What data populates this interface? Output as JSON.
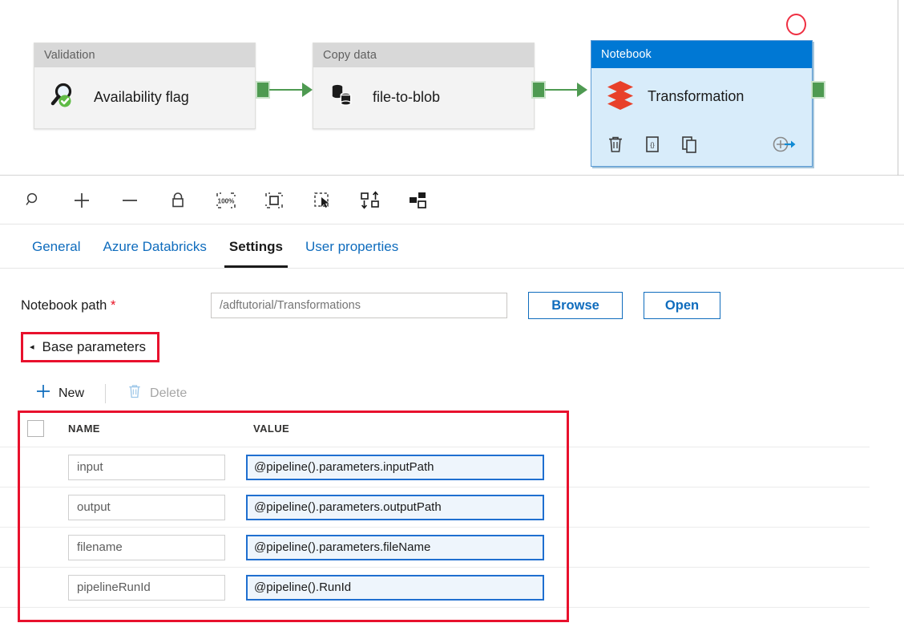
{
  "canvas": {
    "nodes": [
      {
        "type_label": "Validation",
        "name": "Availability flag",
        "icon": "magnifier-check-icon"
      },
      {
        "type_label": "Copy data",
        "name": "file-to-blob",
        "icon": "database-copy-icon"
      },
      {
        "type_label": "Notebook",
        "name": "Transformation",
        "icon": "databricks-layers-icon"
      }
    ],
    "selected_node_actions": [
      {
        "name": "delete-activity-icon",
        "label": "Delete"
      },
      {
        "name": "code-activity-icon",
        "label": "Code"
      },
      {
        "name": "clone-activity-icon",
        "label": "Clone"
      },
      {
        "name": "add-output-icon",
        "label": "Add output"
      }
    ],
    "annotation": "red-circle-highlight"
  },
  "toolbar": {
    "buttons": [
      {
        "name": "zoom-search-icon",
        "label": "Zoom"
      },
      {
        "name": "zoom-in-icon",
        "label": "Zoom in"
      },
      {
        "name": "zoom-out-icon",
        "label": "Zoom out"
      },
      {
        "name": "lock-icon",
        "label": "Lock canvas"
      },
      {
        "name": "zoom-100-percent-icon",
        "label": "100%"
      },
      {
        "name": "fit-to-screen-icon",
        "label": "Zoom to fit"
      },
      {
        "name": "marquee-select-icon",
        "label": "Marquee select"
      },
      {
        "name": "auto-align-icon",
        "label": "Auto align"
      },
      {
        "name": "auto-layout-icon",
        "label": "Auto layout"
      }
    ],
    "zoom_level_label": "100%"
  },
  "tabs": [
    {
      "label": "General",
      "active": false
    },
    {
      "label": "Azure Databricks",
      "active": false
    },
    {
      "label": "Settings",
      "active": true
    },
    {
      "label": "User properties",
      "active": false
    }
  ],
  "settings": {
    "notebook_path": {
      "label": "Notebook path",
      "required_marker": "*",
      "value": "",
      "placeholder": "/adftutorial/Transformations",
      "browse_label": "Browse",
      "open_label": "Open"
    },
    "base_parameters": {
      "caret": "◂",
      "title": "Base parameters",
      "new_label": "New",
      "delete_label": "Delete",
      "columns": [
        "NAME",
        "VALUE"
      ],
      "rows": [
        {
          "name": "input",
          "value": "@pipeline().parameters.inputPath"
        },
        {
          "name": "output",
          "value": "@pipeline().parameters.outputPath"
        },
        {
          "name": "filename",
          "value": "@pipeline().parameters.fileName"
        },
        {
          "name": "pipelineRunId",
          "value": "@pipeline().RunId"
        }
      ]
    }
  },
  "colors": {
    "accent_blue": "#0078d4",
    "link_blue": "#0f6cbd",
    "annotation_red": "#e8112d",
    "connector_green": "#4e9a51",
    "databricks_red": "#e8402a",
    "selected_node_fill": "#d8ecfa"
  }
}
